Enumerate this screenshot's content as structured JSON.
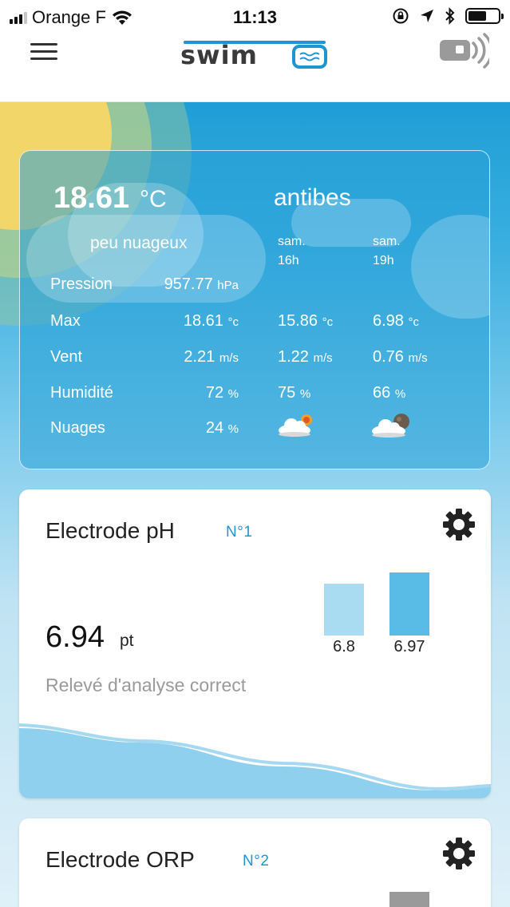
{
  "status_bar": {
    "carrier": "Orange F",
    "time": "11:13"
  },
  "header": {
    "logo_text": "swim"
  },
  "weather": {
    "temperature": "18.61",
    "temperature_unit": "°C",
    "city": "antibes",
    "description": "peu nuageux",
    "forecast_times": [
      {
        "day": "sam.",
        "hour": "16h"
      },
      {
        "day": "sam.",
        "hour": "19h"
      }
    ],
    "rows": [
      {
        "label": "Pression",
        "value": "957.77",
        "unit": "hPa"
      },
      {
        "label": "Max",
        "value": "18.61",
        "unit": "°c",
        "fc1": "15.86",
        "fc1_unit": "°c",
        "fc2": "6.98",
        "fc2_unit": "°c"
      },
      {
        "label": "Vent",
        "value": "2.21",
        "unit": "m/s",
        "fc1": "1.22",
        "fc1_unit": "m/s",
        "fc2": "0.76",
        "fc2_unit": "m/s"
      },
      {
        "label": "Humidité",
        "value": "72",
        "unit": "%",
        "fc1": "75",
        "fc1_unit": "%",
        "fc2": "66",
        "fc2_unit": "%"
      },
      {
        "label": "Nuages",
        "value": "24",
        "unit": "%",
        "fc1_icon": "sun-behind-cloud-icon",
        "fc2_icon": "moon-behind-cloud-icon"
      }
    ]
  },
  "electrode_ph": {
    "title": "Electrode pH",
    "number": "N°1",
    "value": "6.94",
    "unit": "pt",
    "status": "Relevé d'analyse correct",
    "bars": [
      {
        "label": "6.8",
        "value": 6.8
      },
      {
        "label": "6.97",
        "value": 6.97
      }
    ]
  },
  "electrode_orp": {
    "title": "Electrode ORP",
    "number": "N°2"
  },
  "colors": {
    "accent": "#1f95cf",
    "sky": "#3aafe0",
    "sun": "#f3d66a"
  }
}
